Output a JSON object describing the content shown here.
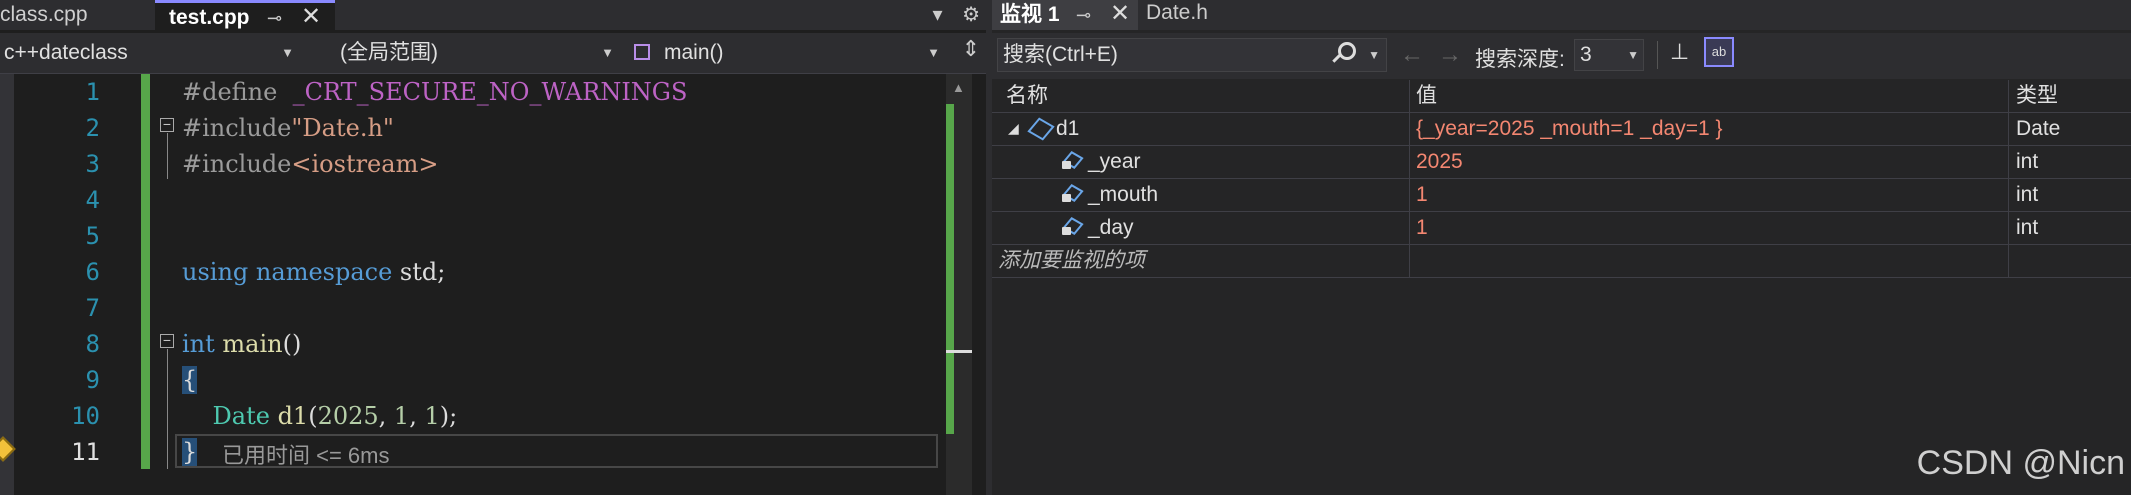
{
  "editor": {
    "tabs": [
      {
        "label": "class.cpp"
      },
      {
        "label": "test.cpp",
        "pin": "⊸",
        "close": "✕"
      }
    ],
    "toolbar": {
      "dropdown": "▾",
      "gear": "⚙"
    },
    "nav": {
      "project": "c++dateclass",
      "scope": "(全局范围)",
      "member": "main()",
      "split": "⇕"
    },
    "line_numbers": [
      "1",
      "2",
      "3",
      "4",
      "5",
      "6",
      "7",
      "8",
      "9",
      "10",
      "11"
    ],
    "code": {
      "l1": {
        "directive": "#define",
        "macro": "_CRT_SECURE_NO_WARNINGS"
      },
      "l2": {
        "directive": "#include",
        "file": "\"Date.h\""
      },
      "l3": {
        "directive": "#include",
        "file": "<iostream>"
      },
      "l6": {
        "kw1": "using",
        "kw2": "namespace",
        "ns": "std;"
      },
      "l8": {
        "kw": "int",
        "fn": "main",
        "paren": "()"
      },
      "l9": {
        "brace": "{"
      },
      "l10": {
        "type": "Date",
        "var": "d1",
        "open": "(",
        "a1": "2025",
        "sep1": ", ",
        "a2": "1",
        "sep2": ", ",
        "a3": "1",
        "close": ");"
      },
      "l11": {
        "brace": "}"
      }
    },
    "perf_tip": "已用时间 <= 6ms"
  },
  "watch": {
    "tabs": [
      {
        "label": "监视 1",
        "pin": "⊸",
        "close": "✕"
      },
      {
        "label": "Date.h"
      }
    ],
    "search": {
      "placeholder": "搜索(Ctrl+E)"
    },
    "nav_arrows": "←→",
    "depth_label": "搜索深度:",
    "depth_value": "3",
    "columns": {
      "name": "名称",
      "value": "值",
      "type": "类型"
    },
    "rows": [
      {
        "name": "d1",
        "value": "{_year=2025 _mouth=1 _day=1 }",
        "type": "Date"
      },
      {
        "name": "_year",
        "value": "2025",
        "type": "int"
      },
      {
        "name": "_mouth",
        "value": "1",
        "type": "int"
      },
      {
        "name": "_day",
        "value": "1",
        "type": "int"
      }
    ],
    "add_item": "添加要监视的项"
  },
  "watermark": "CSDN @Nicn",
  "colors": {
    "accent": "#8a8aff",
    "changed_value": "#f48771",
    "green_bar": "#57a64a"
  }
}
